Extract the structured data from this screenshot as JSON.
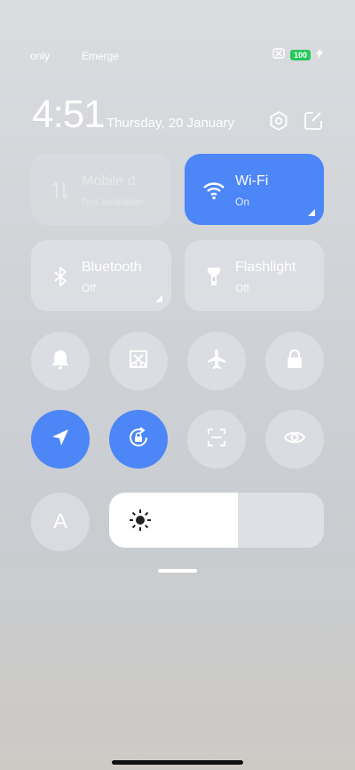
{
  "status_bar": {
    "carrier_1": "only",
    "carrier_2": "Emerge",
    "battery_level": "100",
    "battery_color": "#27c85a"
  },
  "header": {
    "time": "4:51",
    "date": "Thursday, 20 January"
  },
  "tiles": [
    {
      "title": "Mobile d",
      "subtitle": "Not available",
      "icon": "mobile-data-icon",
      "active": false
    },
    {
      "title": "Wi-Fi",
      "subtitle": "On",
      "icon": "wifi-icon",
      "active": true
    },
    {
      "title": "Bluetooth",
      "subtitle": "Off",
      "icon": "bluetooth-icon",
      "active": false
    },
    {
      "title": "Flashlight",
      "subtitle": "Off",
      "icon": "flashlight-icon",
      "active": false
    }
  ],
  "toggles": [
    {
      "icon": "bell-icon",
      "active": false
    },
    {
      "icon": "screenshot-icon",
      "active": false
    },
    {
      "icon": "airplane-icon",
      "active": false
    },
    {
      "icon": "lock-icon",
      "active": false
    },
    {
      "icon": "location-icon",
      "active": true
    },
    {
      "icon": "rotation-lock-icon",
      "active": true
    },
    {
      "icon": "scanner-icon",
      "active": false
    },
    {
      "icon": "eye-icon",
      "active": false
    }
  ],
  "auto_brightness_label": "A",
  "brightness_level": 0.6,
  "accent_color": "#4c86f7"
}
